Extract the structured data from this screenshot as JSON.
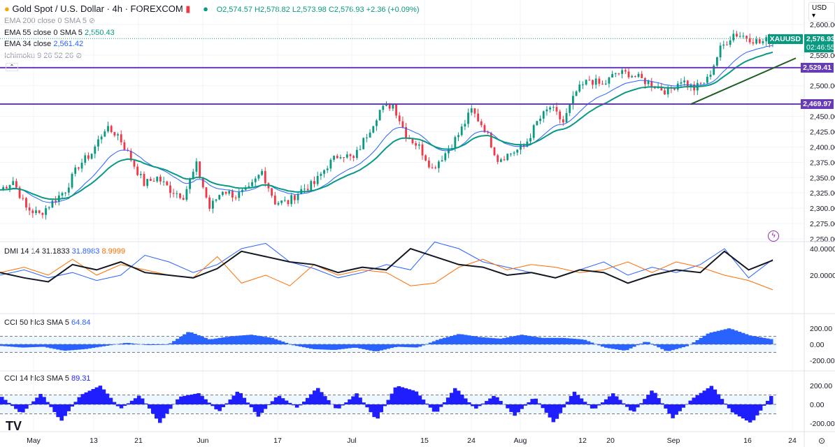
{
  "header": {
    "symbol_title": "Gold Spot / U.S. Dollar · 4h · FOREXCOM",
    "open": "O2,574.57",
    "high": "H2,578.82",
    "low": "L2,573.98",
    "close": "C2,576.93",
    "change": "+2.36 (+0.09%)"
  },
  "indicators": {
    "ema200": "EMA 200 close 0 SMA 5",
    "ema55": "EMA 55 close 0 SMA 5",
    "ema55_value": "2,550.43",
    "ema34": "EMA 34 close",
    "ema34_value": "2,561.42",
    "ichimoku": "Ichimoku 9 26 52 26",
    "dmi": "DMI 14 14",
    "dmi_adx": "31.1833",
    "dmi_plus": "31.8983",
    "dmi_minus": "8.9999",
    "cci50": "CCI 50 hlc3 SMA 5",
    "cci50_value": "64.84",
    "cci14": "CCI 14 hlc3 SMA 5",
    "cci14_value": "89.31"
  },
  "price_axis": {
    "currency": "USD",
    "ticks": [
      "2,600.00",
      "2,550.00",
      "2,500.00",
      "2,450.00",
      "2,425.00",
      "2,400.00",
      "2,375.00",
      "2,350.00",
      "2,325.00",
      "2,300.00",
      "2,275.00",
      "2,250.00"
    ],
    "symbol_tag": "XAUUSD",
    "last_price": "2,576.93",
    "countdown": "02:46:55",
    "level1": "2,529.41",
    "level2": "2,469.97"
  },
  "dmi_axis": [
    "40.0000",
    "20.0000"
  ],
  "cci_axis": [
    "200.00",
    "0.00",
    "-200.00"
  ],
  "time_axis": [
    "May",
    "13",
    "21",
    "Jun",
    "17",
    "Jul",
    "15",
    "24",
    "Aug",
    "12",
    "20",
    "Sep",
    "16",
    "24"
  ],
  "colors": {
    "up": "#089981",
    "down": "#f23645",
    "ema34": "#2962ff",
    "ema55": "#089981",
    "level": "#673ab7",
    "trend": "#1b5e20",
    "plus_di": "#2962ff",
    "minus_di": "#ff6d00",
    "adx": "#131722",
    "cci50": "#2962ff",
    "cci14": "#1e1eff"
  },
  "chart_data": {
    "type": "candlestick",
    "ylim": [
      2250,
      2610
    ],
    "closes": [
      2330,
      2345,
      2300,
      2290,
      2310,
      2330,
      2370,
      2390,
      2430,
      2420,
      2380,
      2340,
      2350,
      2330,
      2320,
      2370,
      2300,
      2330,
      2320,
      2330,
      2360,
      2310,
      2310,
      2330,
      2340,
      2370,
      2390,
      2380,
      2420,
      2460,
      2470,
      2420,
      2400,
      2365,
      2390,
      2420,
      2460,
      2430,
      2380,
      2390,
      2400,
      2440,
      2465,
      2440,
      2490,
      2510,
      2500,
      2520,
      2520,
      2510,
      2500,
      2490,
      2510,
      2495,
      2510,
      2560,
      2585,
      2580,
      2570,
      2576.93
    ],
    "horizontal_levels": [
      2529.41,
      2469.97
    ],
    "trendline": [
      [
        2469.97,
        "Sep 2"
      ],
      [
        2545,
        "Sep 20"
      ]
    ],
    "dmi": {
      "ylim": [
        0,
        50
      ],
      "plus_di": [
        20,
        24,
        18,
        22,
        16,
        20,
        35,
        30,
        22,
        28,
        40,
        44,
        30,
        25,
        18,
        22,
        28,
        24,
        45,
        40,
        30,
        26,
        22,
        18,
        24,
        30,
        20,
        26,
        22,
        28,
        40,
        18,
        31.9
      ],
      "minus_di": [
        22,
        26,
        20,
        32,
        20,
        28,
        24,
        20,
        18,
        34,
        14,
        20,
        12,
        28,
        20,
        24,
        22,
        12,
        14,
        26,
        32,
        24,
        28,
        26,
        22,
        24,
        30,
        22,
        30,
        26,
        20,
        16,
        9
      ],
      "adx": [
        22,
        18,
        15,
        28,
        24,
        30,
        22,
        20,
        18,
        25,
        38,
        34,
        30,
        28,
        22,
        26,
        24,
        40,
        34,
        28,
        26,
        20,
        22,
        18,
        24,
        22,
        14,
        20,
        24,
        22,
        38,
        24,
        31.2
      ]
    },
    "cci50": {
      "ylim": [
        -300,
        300
      ],
      "values": [
        -20,
        -40,
        -30,
        -80,
        -60,
        -20,
        20,
        -10,
        -5,
        160,
        60,
        100,
        120,
        80,
        -10,
        -60,
        -70,
        -40,
        -90,
        -30,
        -40,
        60,
        130,
        90,
        70,
        120,
        80,
        80,
        60,
        -40,
        -80,
        40,
        -90,
        -20,
        140,
        200,
        110,
        65
      ]
    },
    "cci14": {
      "ylim": [
        -300,
        300
      ],
      "values": [
        80,
        -100,
        120,
        -180,
        100,
        200,
        -50,
        100,
        -200,
        80,
        120,
        -80,
        150,
        -130,
        100,
        -40,
        180,
        -60,
        120,
        -170,
        200,
        140,
        -100,
        180,
        -50,
        100,
        -120,
        80,
        -200,
        140,
        -60,
        120,
        -90,
        160,
        -150,
        60,
        200,
        -80,
        -200,
        89
      ]
    }
  }
}
